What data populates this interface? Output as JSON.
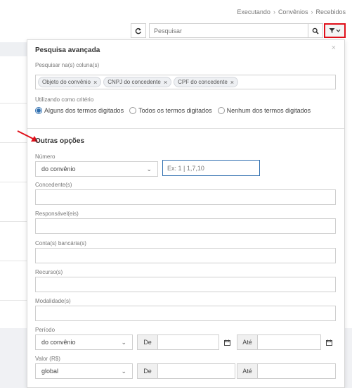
{
  "breadcrumb": [
    "Executando",
    "Convênios",
    "Recebidos"
  ],
  "toolbar": {
    "search_placeholder": "Pesquisar"
  },
  "panel": {
    "title": "Pesquisa avançada",
    "close": "×",
    "columns_label": "Pesquisar na(s) coluna(s)",
    "tags": [
      "Objeto do convênio",
      "CNPJ do concedente",
      "CPF do concedente"
    ],
    "tag_remove": "×",
    "criteria_label": "Utilizando como critério",
    "criteria_options": [
      "Alguns dos termos digitados",
      "Todos os termos digitados",
      "Nenhum dos termos digitados"
    ],
    "criteria_selected": 0,
    "section_title": "Outras opções",
    "numero_label": "Número",
    "numero_select": "do convênio",
    "numero_placeholder": "Ex: 1 | 1,7,10",
    "concedente_label": "Concedente(s)",
    "responsavel_label": "Responsável(eis)",
    "conta_label": "Conta(s) bancária(s)",
    "recurso_label": "Recurso(s)",
    "modalidade_label": "Modalidade(s)",
    "periodo_label": "Período",
    "periodo_select": "do convênio",
    "de_label": "De",
    "ate_label": "Até",
    "valor_label": "Valor (R$)",
    "valor_select": "global"
  },
  "colors": {
    "accent": "#2f6fb0",
    "highlight_border": "#e0101a",
    "arrow": "#e0101a"
  }
}
